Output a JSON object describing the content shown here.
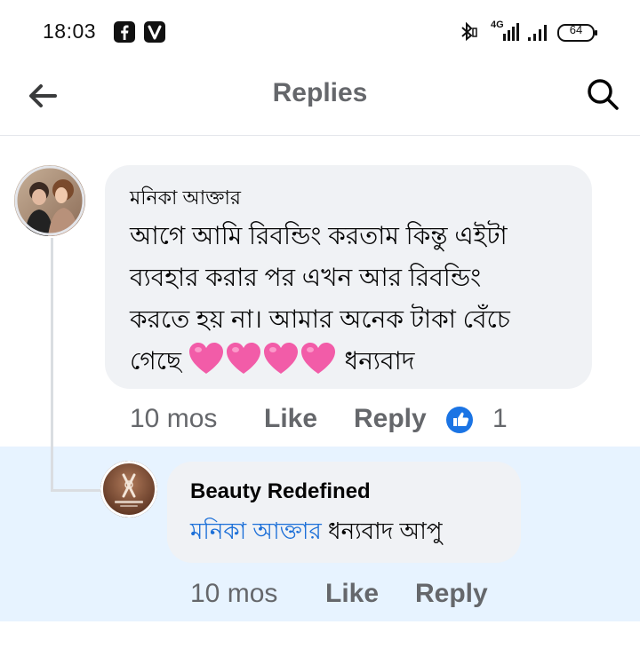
{
  "status_bar": {
    "time": "18:03",
    "network": "4G",
    "battery": "64",
    "app_icons": [
      "facebook-icon",
      "viber-icon"
    ]
  },
  "header": {
    "title": "Replies",
    "back_icon": "arrow-left-icon",
    "search_icon": "search-icon"
  },
  "comment": {
    "author": "মনিকা আক্তার",
    "lines": [
      "আগে আমি রিবন্ডিং করতাম কিন্তু এইটা",
      "ব্যবহার করার পর এখন আর রিবন্ডিং",
      "করতে হয় না। আমার অনেক টাকা বেঁচে",
      "গেছে"
    ],
    "emoji": "pink-heart-icon x4",
    "trailing_text": "ধন্যবাদ",
    "time": "10 mos",
    "like_label": "Like",
    "reply_label": "Reply",
    "like_count": "1"
  },
  "reply": {
    "author": "Beauty Redefined",
    "mention": "মনিকা আক্তার",
    "text": "ধন্যবাদ আপু",
    "time": "10 mos",
    "like_label": "Like",
    "reply_label": "Reply"
  },
  "colors": {
    "bubble_bg": "#f0f2f5",
    "highlight_bg": "#e7f3ff",
    "secondary_text": "#65676b",
    "mention_blue": "#1b6fd8",
    "like_blue": "#1b74e4",
    "heart_pink": "#f25ca8"
  }
}
